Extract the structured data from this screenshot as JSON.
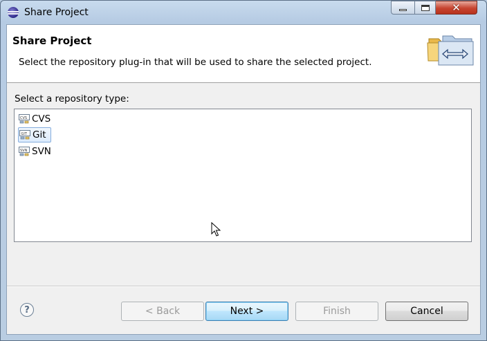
{
  "window": {
    "title": "Share Project"
  },
  "header": {
    "title": "Share Project",
    "description": "Select the repository plug-in that will be used to share the selected project."
  },
  "prompt": "Select a repository type:",
  "repositories": [
    {
      "label": "CVS",
      "icon": "cvs-icon",
      "selected": false
    },
    {
      "label": "Git",
      "icon": "git-icon",
      "selected": true
    },
    {
      "label": "SVN",
      "icon": "svn-icon",
      "selected": false
    }
  ],
  "buttons": {
    "back": "< Back",
    "next": "Next >",
    "finish": "Finish",
    "cancel": "Cancel"
  },
  "window_controls": {
    "close": "✕"
  },
  "help_symbol": "?",
  "colors": {
    "selection_border": "#84acdd",
    "default_button_border": "#3c7fb1",
    "close_button": "#c7442f"
  }
}
